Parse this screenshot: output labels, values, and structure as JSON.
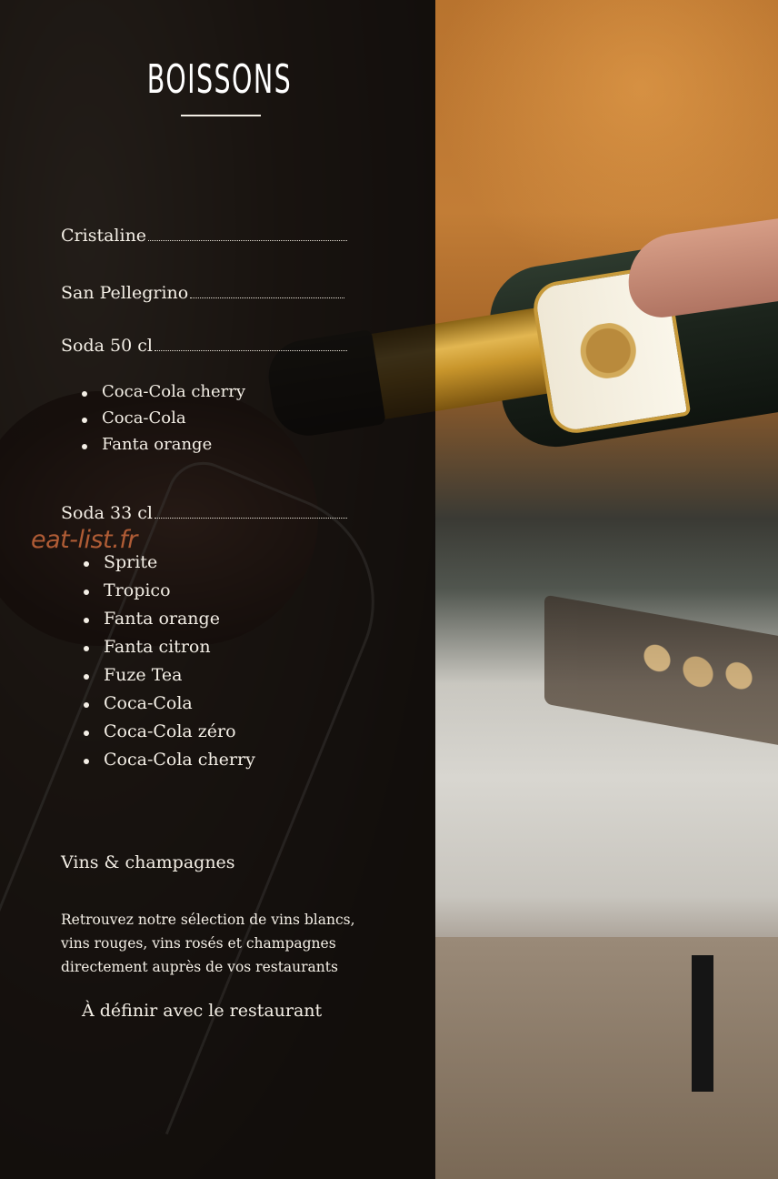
{
  "menu": {
    "title": "BOISSONS",
    "items": [
      {
        "name": "Cristaline"
      },
      {
        "name": "San Pellegrino"
      },
      {
        "name": "Soda 50 cl",
        "options": [
          "Coca-Cola cherry",
          "Coca-Cola",
          "Fanta orange"
        ]
      },
      {
        "name": "Soda 33 cl",
        "options": [
          "Sprite",
          "Tropico",
          "Fanta orange",
          "Fanta citron",
          "Fuze Tea",
          "Coca-Cola",
          "Coca-Cola zéro",
          "Coca-Cola cherry"
        ]
      }
    ],
    "watermark": "eat-list.fr",
    "wines": {
      "title": "Vins & champagnes",
      "description": "Retrouvez notre sélection de vins blancs, vins rouges, vins rosés et champagnes directement auprès de vos restaurants",
      "note": "À définir avec le restaurant"
    }
  }
}
